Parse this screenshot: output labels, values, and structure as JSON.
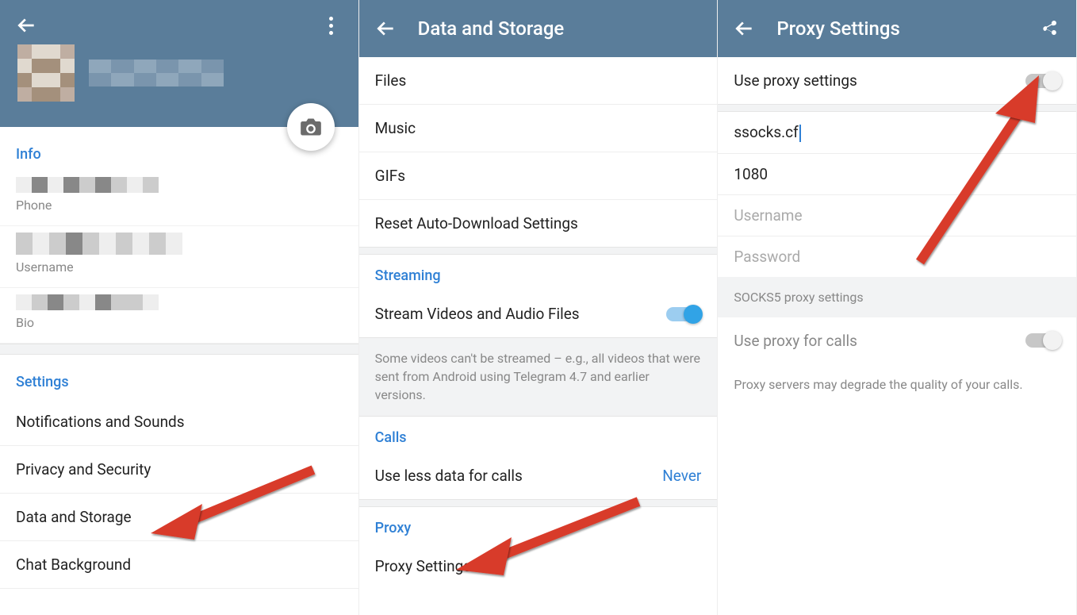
{
  "panel1": {
    "info_header": "Info",
    "phone_label": "Phone",
    "username_label": "Username",
    "bio_label": "Bio",
    "settings_header": "Settings",
    "items": [
      "Notifications and Sounds",
      "Privacy and Security",
      "Data and Storage",
      "Chat Background"
    ]
  },
  "panel2": {
    "title": "Data and Storage",
    "rows": {
      "files": "Files",
      "music": "Music",
      "gifs": "GIFs",
      "reset": "Reset Auto-Download Settings"
    },
    "streaming_header": "Streaming",
    "stream_label": "Stream Videos and Audio Files",
    "stream_desc": "Some videos can't be streamed – e.g., all videos that were sent from Android using Telegram 4.7 and earlier versions.",
    "calls_header": "Calls",
    "use_less_data": "Use less data for calls",
    "use_less_data_value": "Never",
    "proxy_header": "Proxy",
    "proxy_settings": "Proxy Settings"
  },
  "panel3": {
    "title": "Proxy Settings",
    "use_proxy": "Use proxy settings",
    "server_value": "ssocks.cf",
    "port_value": "1080",
    "username_ph": "Username",
    "password_ph": "Password",
    "socks_label": "SOCKS5 proxy settings",
    "use_for_calls": "Use proxy for calls",
    "calls_desc": "Proxy servers may degrade the quality of your calls."
  }
}
